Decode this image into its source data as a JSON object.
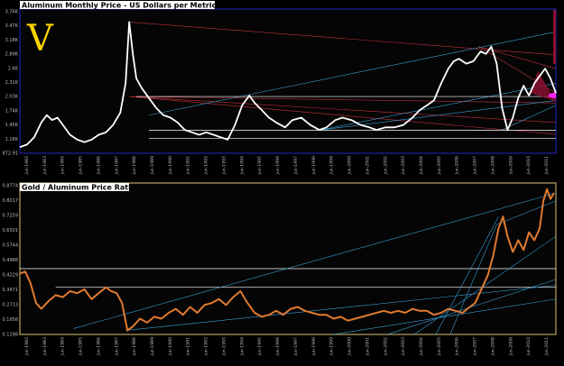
{
  "logo": {
    "text": "V",
    "color": "#ffd400"
  },
  "colors": {
    "background": "#000000",
    "panel1_border": "#1a1a8a",
    "panel2_border": "#b8a460",
    "aluminum_line": "#ffffff",
    "ratio_line": "#e07a30",
    "trend_blue": "#3aa0d8",
    "trend_red": "#c0303a",
    "support_white": "#ffffff",
    "fill_red": "#8a1030",
    "marker_magenta": "#ff22ff"
  },
  "chart_data": [
    {
      "type": "line",
      "title": "Aluminum Monthly Price - US Dollars per Metric Ton",
      "ylabel": "",
      "xlabel": "",
      "y_ticks": [
        "872.91",
        "1.16K",
        "1.45K",
        "1.74K",
        "2.03K",
        "2.31K",
        "2.6K",
        "2.89K",
        "3.18K",
        "3.47K",
        "3.76K"
      ],
      "ylim": [
        872.91,
        3760
      ],
      "x_ticks": [
        "Jun-1982",
        "Jun-1983",
        "Jun-1984",
        "Jun-1985",
        "Jun-1986",
        "Jun-1987",
        "Jun-1988",
        "Jun-1989",
        "Jun-1990",
        "Jun-1991",
        "Jun-1992",
        "Jun-1993",
        "Jun-1994",
        "Jun-1995",
        "Jun-1996",
        "Jun-1997",
        "Jun-1998",
        "Jun-1999",
        "Jun-2000",
        "Jun-2001",
        "Jun-2002",
        "Jun-2003",
        "Jun-2004",
        "Jun-2005",
        "Jun-2006",
        "Jun-2007",
        "Jun-2008",
        "Jun-2009",
        "Jun-2010",
        "Jun-2011"
      ],
      "xlim": [
        1982.0,
        2011.9
      ],
      "grid": false,
      "series": [
        {
          "x": [
            1982.0,
            1982.4,
            1982.8,
            1983.2,
            1983.5,
            1983.8,
            1984.1,
            1984.4,
            1984.8,
            1985.2,
            1985.6,
            1986.0,
            1986.4,
            1986.8,
            1987.2,
            1987.6,
            1987.9,
            1988.1,
            1988.3,
            1988.5,
            1988.8,
            1989.2,
            1989.6,
            1990.0,
            1990.4,
            1990.8,
            1991.2,
            1991.6,
            1992.0,
            1992.4,
            1992.8,
            1993.2,
            1993.6,
            1994.0,
            1994.4,
            1994.8,
            1995.1,
            1995.5,
            1995.9,
            1996.3,
            1996.8,
            1997.2,
            1997.7,
            1998.2,
            1998.7,
            1999.1,
            1999.6,
            2000.0,
            2000.5,
            2001.0,
            2001.5,
            2001.9,
            2002.4,
            2002.9,
            2003.4,
            2003.9,
            2004.3,
            2004.7,
            2005.1,
            2005.5,
            2005.9,
            2006.2,
            2006.5,
            2006.9,
            2007.3,
            2007.7,
            2008.0,
            2008.3,
            2008.6,
            2008.9,
            2009.2,
            2009.5,
            2009.8,
            2010.1,
            2010.4,
            2010.7,
            2011.0,
            2011.3,
            2011.6,
            2011.9
          ],
          "y": [
            1000,
            1050,
            1200,
            1500,
            1650,
            1550,
            1600,
            1450,
            1250,
            1150,
            1100,
            1150,
            1250,
            1300,
            1450,
            1700,
            2300,
            3550,
            2900,
            2400,
            2200,
            2000,
            1800,
            1650,
            1600,
            1500,
            1350,
            1300,
            1250,
            1300,
            1250,
            1200,
            1150,
            1450,
            1850,
            2050,
            1900,
            1750,
            1600,
            1500,
            1400,
            1550,
            1600,
            1450,
            1350,
            1400,
            1550,
            1600,
            1550,
            1450,
            1400,
            1350,
            1400,
            1400,
            1450,
            1600,
            1750,
            1850,
            1950,
            2300,
            2600,
            2750,
            2800,
            2700,
            2750,
            2950,
            2900,
            3050,
            2700,
            1800,
            1350,
            1600,
            2000,
            2250,
            2050,
            2300,
            2450,
            2600,
            2400,
            2100
          ]
        }
      ]
    },
    {
      "type": "line",
      "title": "Gold / Aluminum Price Ratio",
      "ylabel": "",
      "xlabel": "",
      "y_ticks": [
        "0.1198",
        "0.1956",
        "0.2713",
        "0.3471",
        "0.4229",
        "0.4986",
        "0.5744",
        "0.6501",
        "0.7259",
        "0.8017",
        "0.8774"
      ],
      "ylim": [
        0.1198,
        0.8774
      ],
      "x_ticks": [
        "Jun-1982",
        "Jun-1983",
        "Jun-1984",
        "Jun-1985",
        "Jun-1986",
        "Jun-1987",
        "Jun-1988",
        "Jun-1989",
        "Jun-1990",
        "Jun-1991",
        "Jun-1992",
        "Jun-1993",
        "Jun-1994",
        "Jun-1995",
        "Jun-1996",
        "Jun-1997",
        "Jun-1998",
        "Jun-1999",
        "Jun-2000",
        "Jun-2001",
        "Jun-2002",
        "Jun-2003",
        "Jun-2004",
        "Jun-2005",
        "Jun-2006",
        "Jun-2007",
        "Jun-2008",
        "Jun-2009",
        "Jun-2010",
        "Jun-2011"
      ],
      "xlim": [
        1982.0,
        2011.9
      ],
      "grid": false,
      "series": [
        {
          "x": [
            1982.0,
            1982.3,
            1982.6,
            1982.9,
            1983.2,
            1983.6,
            1984.0,
            1984.4,
            1984.8,
            1985.2,
            1985.6,
            1986.0,
            1986.4,
            1986.8,
            1987.1,
            1987.4,
            1987.7,
            1988.0,
            1988.3,
            1988.7,
            1989.1,
            1989.5,
            1989.9,
            1990.3,
            1990.7,
            1991.1,
            1991.5,
            1991.9,
            1992.3,
            1992.7,
            1993.1,
            1993.5,
            1993.9,
            1994.3,
            1994.7,
            1995.1,
            1995.5,
            1995.9,
            1996.3,
            1996.7,
            1997.1,
            1997.5,
            1997.9,
            1998.3,
            1998.7,
            1999.1,
            1999.5,
            1999.9,
            2000.3,
            2000.7,
            2001.1,
            2001.5,
            2001.9,
            2002.3,
            2002.7,
            2003.1,
            2003.5,
            2003.9,
            2004.3,
            2004.7,
            2005.1,
            2005.5,
            2005.9,
            2006.3,
            2006.7,
            2007.1,
            2007.4,
            2007.8,
            2008.1,
            2008.4,
            2008.7,
            2008.95,
            2009.2,
            2009.5,
            2009.8,
            2010.1,
            2010.4,
            2010.7,
            2011.0,
            2011.2,
            2011.4,
            2011.6,
            2011.8
          ],
          "y": [
            0.43,
            0.44,
            0.38,
            0.28,
            0.25,
            0.29,
            0.32,
            0.31,
            0.34,
            0.33,
            0.35,
            0.3,
            0.33,
            0.36,
            0.34,
            0.33,
            0.28,
            0.14,
            0.16,
            0.2,
            0.18,
            0.21,
            0.2,
            0.23,
            0.25,
            0.22,
            0.26,
            0.23,
            0.27,
            0.28,
            0.3,
            0.27,
            0.31,
            0.34,
            0.28,
            0.23,
            0.21,
            0.22,
            0.24,
            0.22,
            0.25,
            0.26,
            0.24,
            0.23,
            0.22,
            0.22,
            0.2,
            0.21,
            0.19,
            0.2,
            0.21,
            0.22,
            0.23,
            0.24,
            0.23,
            0.24,
            0.23,
            0.25,
            0.24,
            0.24,
            0.22,
            0.23,
            0.25,
            0.24,
            0.23,
            0.26,
            0.28,
            0.36,
            0.42,
            0.52,
            0.66,
            0.72,
            0.62,
            0.54,
            0.6,
            0.55,
            0.64,
            0.6,
            0.66,
            0.8,
            0.86,
            0.81,
            0.84
          ]
        }
      ]
    }
  ]
}
